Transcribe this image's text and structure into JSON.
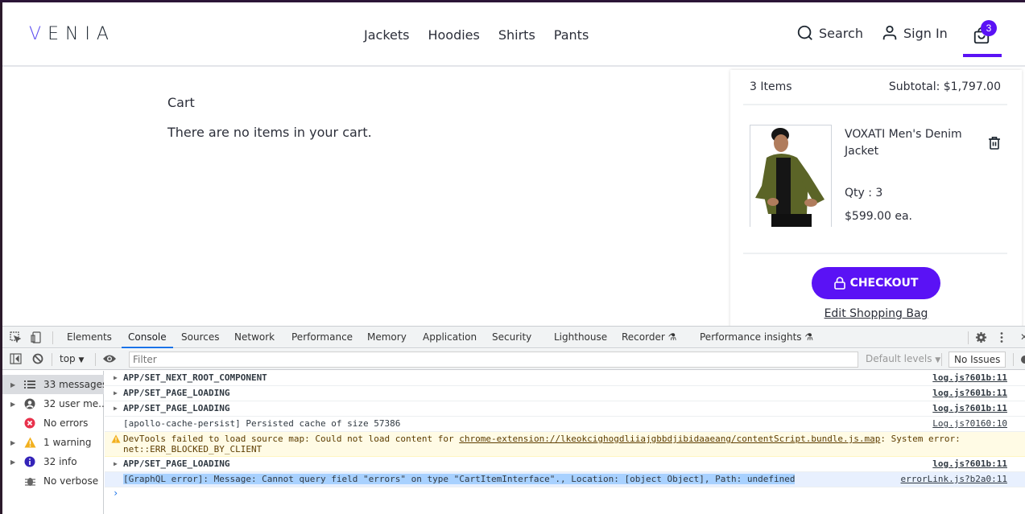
{
  "header": {
    "logo": "VENIA",
    "nav": [
      "Jackets",
      "Hoodies",
      "Shirts",
      "Pants"
    ],
    "search_label": "Search",
    "signin_label": "Sign In",
    "cart_count": "3",
    "accent_color": "#5a12f5"
  },
  "main": {
    "title": "Cart",
    "empty_message": "There are no items in your cart."
  },
  "minicart": {
    "items_count": "3 Items",
    "subtotal": "Subtotal: $1,797.00",
    "items": [
      {
        "name": "VOXATI Men's Denim Jacket",
        "qty": "Qty : 3",
        "price": "$599.00 ea."
      }
    ],
    "checkout_label": "CHECKOUT",
    "edit_label": "Edit Shopping Bag"
  },
  "devtools": {
    "tabs": [
      "Elements",
      "Console",
      "Sources",
      "Network",
      "Performance",
      "Memory",
      "Application",
      "Security",
      "Lighthouse",
      "Recorder",
      "Performance insights"
    ],
    "active_tab": "Console",
    "context": "top",
    "filter_placeholder": "Filter",
    "levels": "Default levels",
    "issues": "No Issues",
    "sidebar": [
      {
        "label": "33 messages",
        "icon": "list-icon"
      },
      {
        "label": "32 user me...",
        "icon": "user-icon"
      },
      {
        "label": "No errors",
        "icon": "error-icon"
      },
      {
        "label": "1 warning",
        "icon": "warning-icon"
      },
      {
        "label": "32 info",
        "icon": "info-icon"
      },
      {
        "label": "No verbose",
        "icon": "bug-icon"
      }
    ],
    "logs": [
      {
        "text": "APP/SET_NEXT_ROOT_COMPONENT",
        "source": "log.js?601b:11",
        "type": "group"
      },
      {
        "text": "APP/SET_PAGE_LOADING",
        "source": "log.js?601b:11",
        "type": "group"
      },
      {
        "text": "APP/SET_PAGE_LOADING",
        "source": "log.js?601b:11",
        "type": "group"
      },
      {
        "text": "[apollo-cache-persist] Persisted cache of size 57386",
        "source": "Log.js?0160:10",
        "type": "log"
      },
      {
        "text_pre": "DevTools failed to load source map: Could not load content for ",
        "link": "chrome-extension://lkeokcighogdliiajgbbdjibidaaeang/contentScript.bundle.js.map",
        "text_post": ": System error:",
        "line2": "net::ERR_BLOCKED_BY_CLIENT",
        "type": "warning"
      },
      {
        "text": "APP/SET_PAGE_LOADING",
        "source": "log.js?601b:11",
        "type": "group"
      },
      {
        "text": "[GraphQL error]: Message: Cannot query field \"errors\" on type \"CartItemInterface\"., Location: [object Object], Path: undefined",
        "source": "errorLink.js?b2a0:11",
        "type": "selected"
      }
    ]
  }
}
